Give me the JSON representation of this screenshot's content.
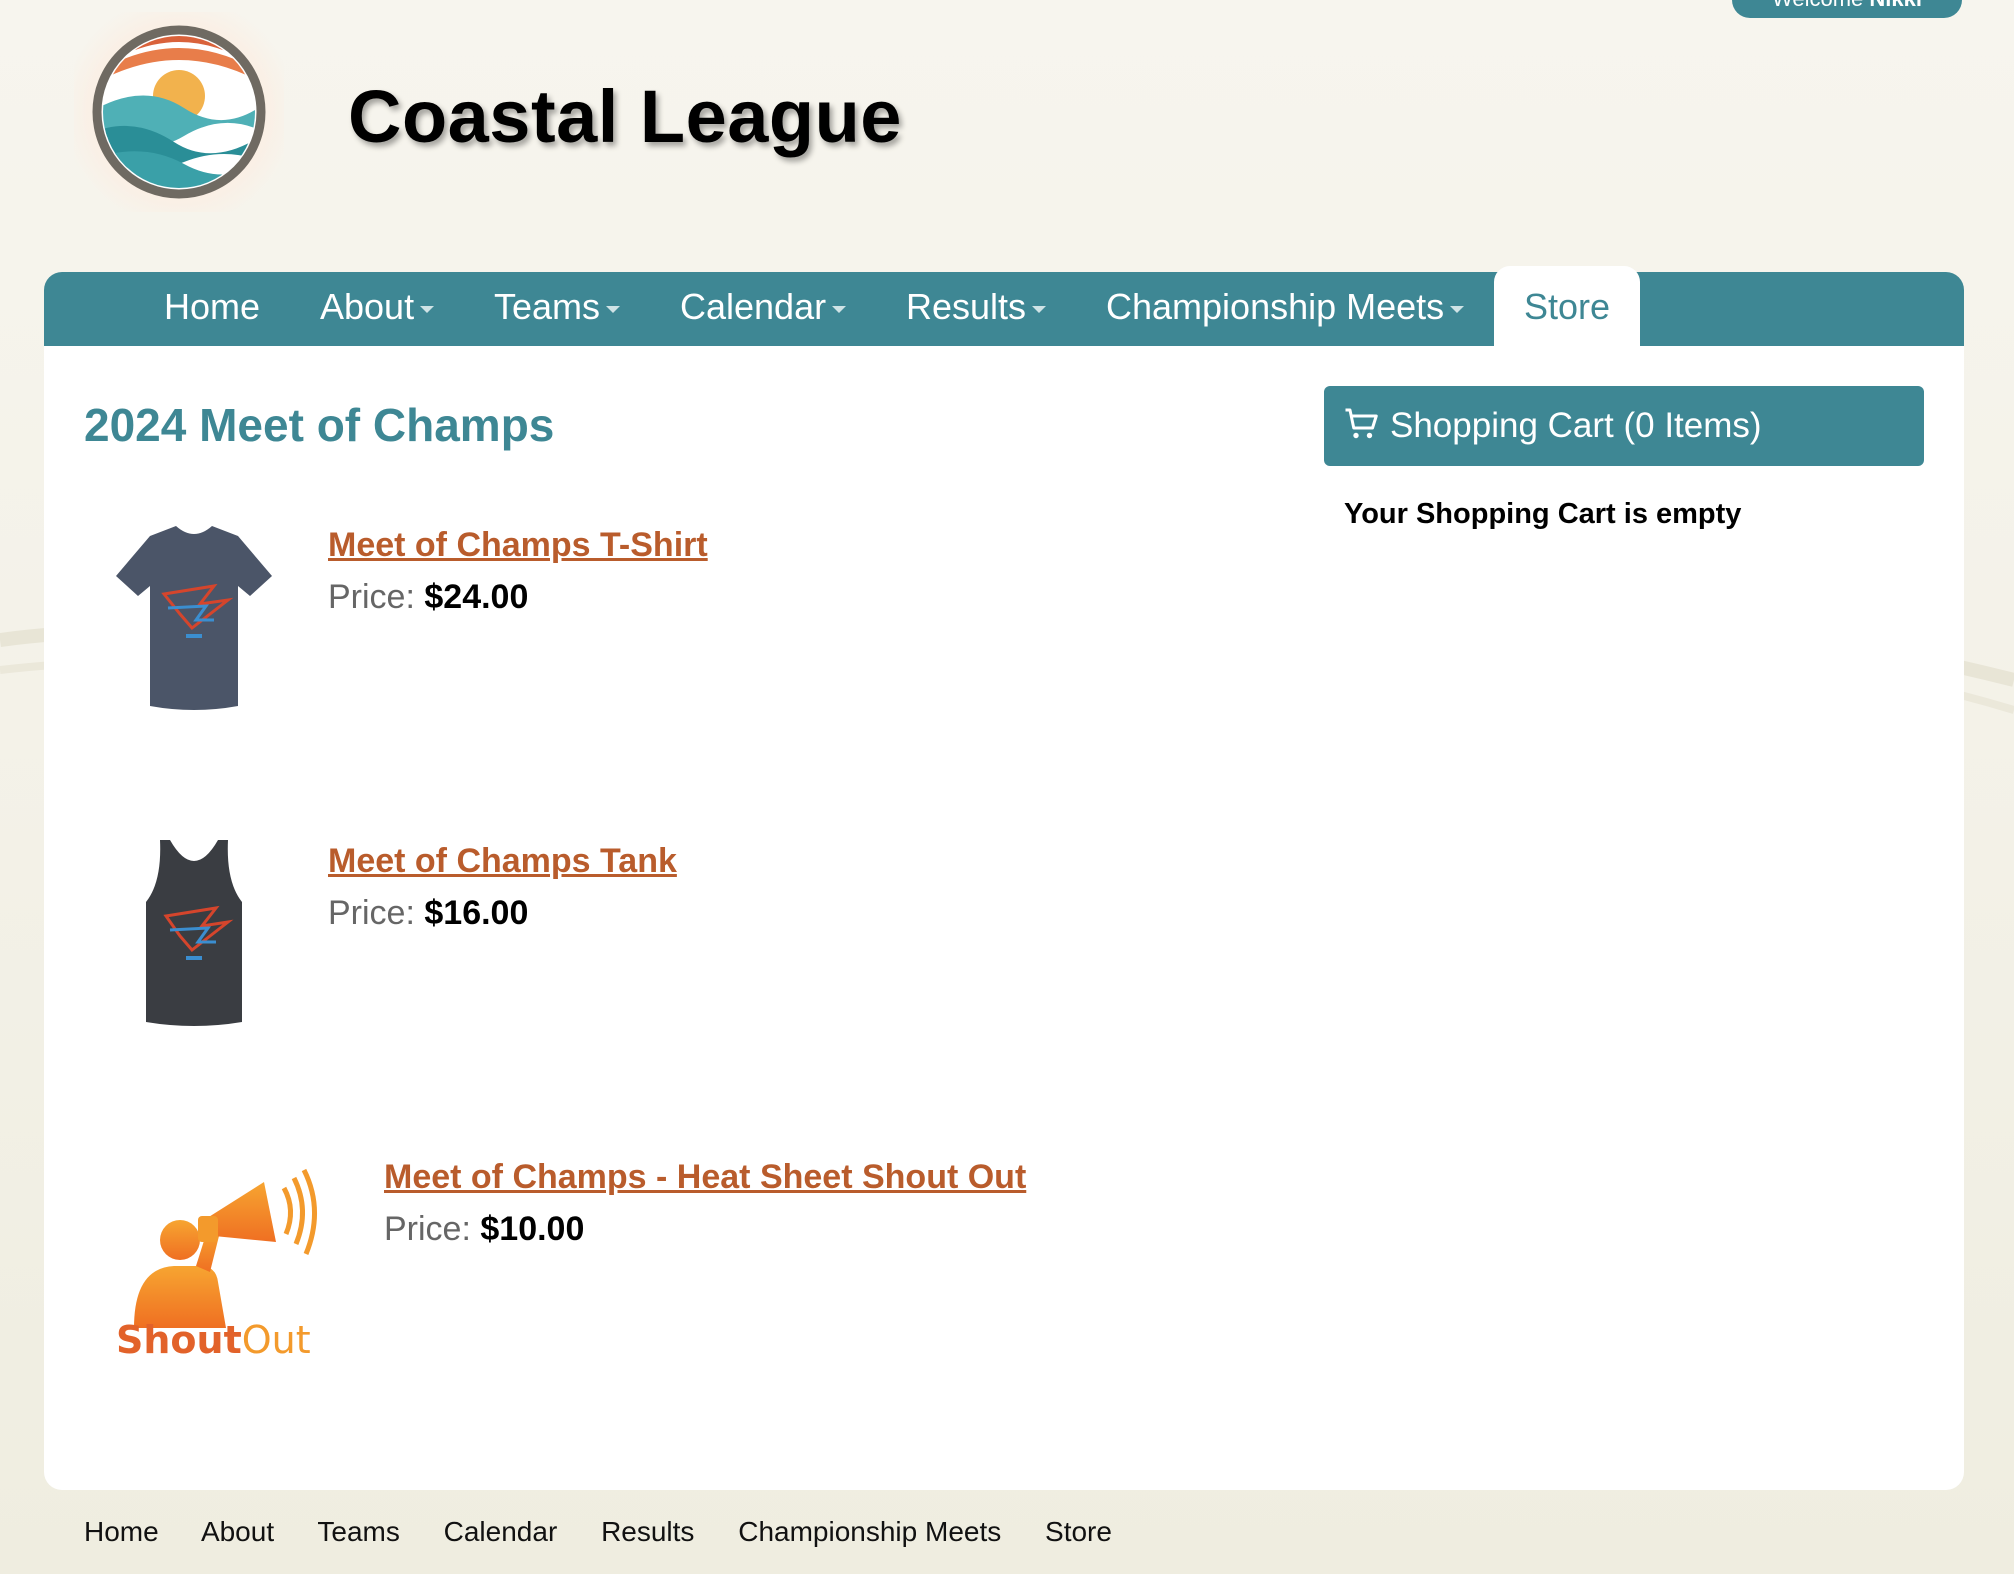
{
  "header": {
    "welcome_prefix": "Welcome",
    "welcome_user": "Nikki",
    "site_title": "Coastal League",
    "logo_icon": "coastal-league-logo"
  },
  "nav": {
    "items": [
      {
        "label": "Home",
        "dropdown": false
      },
      {
        "label": "About",
        "dropdown": true
      },
      {
        "label": "Teams",
        "dropdown": true
      },
      {
        "label": "Calendar",
        "dropdown": true
      },
      {
        "label": "Results",
        "dropdown": true
      },
      {
        "label": "Championship Meets",
        "dropdown": true
      },
      {
        "label": "Store",
        "dropdown": false,
        "active": true
      }
    ]
  },
  "main": {
    "title": "2024 Meet of Champs",
    "price_label": "Price:",
    "products": [
      {
        "name": "Meet of Champs T-Shirt",
        "price": "$24.00",
        "image_icon": "tshirt-icon"
      },
      {
        "name": "Meet of Champs Tank",
        "price": "$16.00",
        "image_icon": "tank-top-icon"
      },
      {
        "name": "Meet of Champs - Heat Sheet Shout Out",
        "price": "$10.00",
        "image_icon": "shoutout-logo",
        "image_text_bold": "Shout",
        "image_text_light": "Out"
      }
    ]
  },
  "cart": {
    "title": "Shopping Cart (0 Items)",
    "empty_message": "Your Shopping Cart is empty",
    "icon": "cart-icon"
  },
  "footer": {
    "items": [
      "Home",
      "About",
      "Teams",
      "Calendar",
      "Results",
      "Championship Meets",
      "Store"
    ]
  },
  "colors": {
    "brand": "#3e8794",
    "link": "#b95c2c",
    "background": "#f5f3ea"
  }
}
